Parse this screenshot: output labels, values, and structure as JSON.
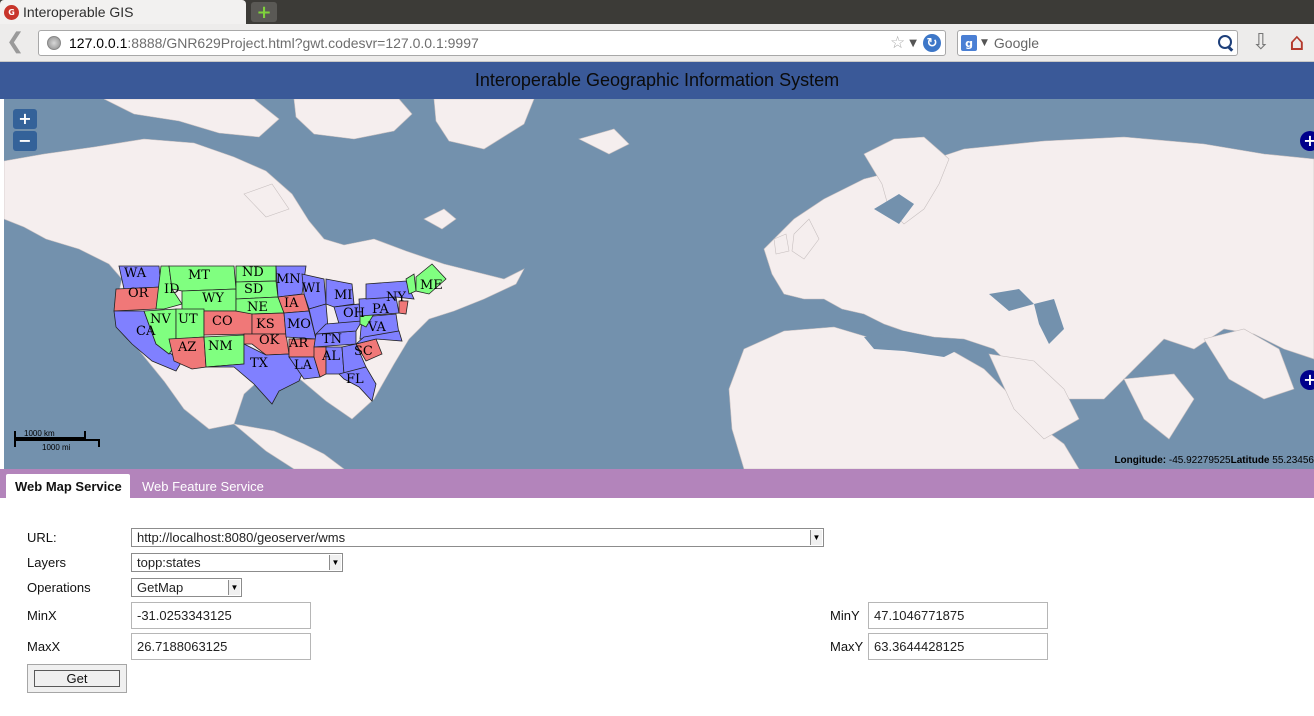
{
  "browser": {
    "tab_title": "Interoperable GIS",
    "url_host": "127.0.0.1",
    "url_rest": ":8888/GNR629Project.html?gwt.codesvr=127.0.0.1:9997",
    "search_placeholder": "Google"
  },
  "app": {
    "title": "Interoperable Geographic Information System"
  },
  "map": {
    "zoom_in": "+",
    "zoom_out": "−",
    "scale_km": "1000 km",
    "scale_mi": "1000 mi",
    "longitude_label": "Longitude:",
    "longitude_value": "-45.92279525",
    "latitude_label": "Latitude",
    "latitude_value": "55.23456",
    "layer_toggle": "+",
    "colors": {
      "water": "#7391ad",
      "land": "#f5eeee",
      "purple": "#8080ff",
      "green": "#80ff80",
      "red": "#f07878"
    },
    "states": [
      "WA",
      "OR",
      "MT",
      "ND",
      "SD",
      "WY",
      "ID",
      "NE",
      "MN",
      "WI",
      "MI",
      "IA",
      "NV",
      "UT",
      "CO",
      "KS",
      "MO",
      "CA",
      "AZ",
      "NM",
      "OK",
      "AR",
      "TX",
      "LA",
      "TN",
      "AL",
      "SC",
      "FL",
      "OH",
      "PA",
      "NY",
      "VA",
      "ME"
    ]
  },
  "tabs": {
    "wms": "Web Map Service",
    "wfs": "Web Feature Service"
  },
  "form": {
    "url_label": "URL:",
    "url_value": "http://localhost:8080/geoserver/wms",
    "layers_label": "Layers",
    "layers_value": "topp:states",
    "operations_label": "Operations",
    "operations_value": "GetMap",
    "minx_label": "MinX",
    "minx_value": "-31.0253343125",
    "maxx_label": "MaxX",
    "maxx_value": "26.7188063125",
    "miny_label": "MinY",
    "miny_value": "47.1046771875",
    "maxy_label": "MaxY",
    "maxy_value": "63.3644428125",
    "get_button": "Get"
  }
}
